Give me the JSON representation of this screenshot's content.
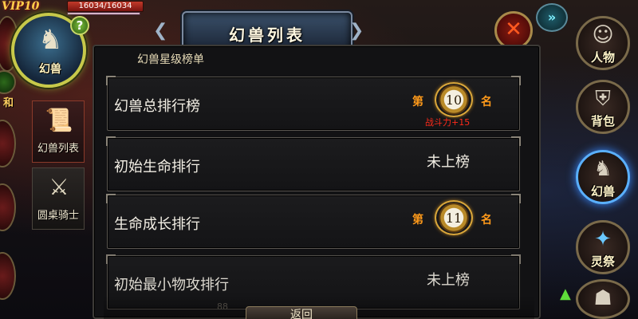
{
  "hud": {
    "vip": "VIP10",
    "hp_text": "16034/16034",
    "avatar_label": "幻兽",
    "help": "?",
    "left_partial_label": "和"
  },
  "title": "幻兽列表",
  "panel": {
    "heading": "幻兽星级榜单",
    "rows": [
      {
        "label": "幻兽总排行榜",
        "rank": "10",
        "di": "第",
        "ming": "名",
        "power": "战斗力+15"
      },
      {
        "label": "初始生命排行",
        "rank_text": "未上榜"
      },
      {
        "label": "生命成长排行",
        "rank": "11",
        "di": "第",
        "ming": "名"
      },
      {
        "label": "初始最小物攻排行",
        "rank_text": "未上榜"
      }
    ],
    "bottom_number": "88",
    "back_button": "返回"
  },
  "left_tabs": [
    {
      "label": "幻兽列表",
      "icon": "scroll-icon"
    },
    {
      "label": "圆桌骑士",
      "icon": "crossed-swords-icon"
    }
  ],
  "right_menu": [
    {
      "label": "人物",
      "icon": "hero-portrait-icon"
    },
    {
      "label": "背包",
      "icon": "backpack-icon"
    },
    {
      "label": "幻兽",
      "icon": "unicorn-icon"
    },
    {
      "label": "灵祭",
      "icon": "spirit-icon"
    }
  ],
  "colors": {
    "accent": "#ff9a1a",
    "power": "#ff2a1a",
    "active_ring": "#5ab0ff"
  }
}
